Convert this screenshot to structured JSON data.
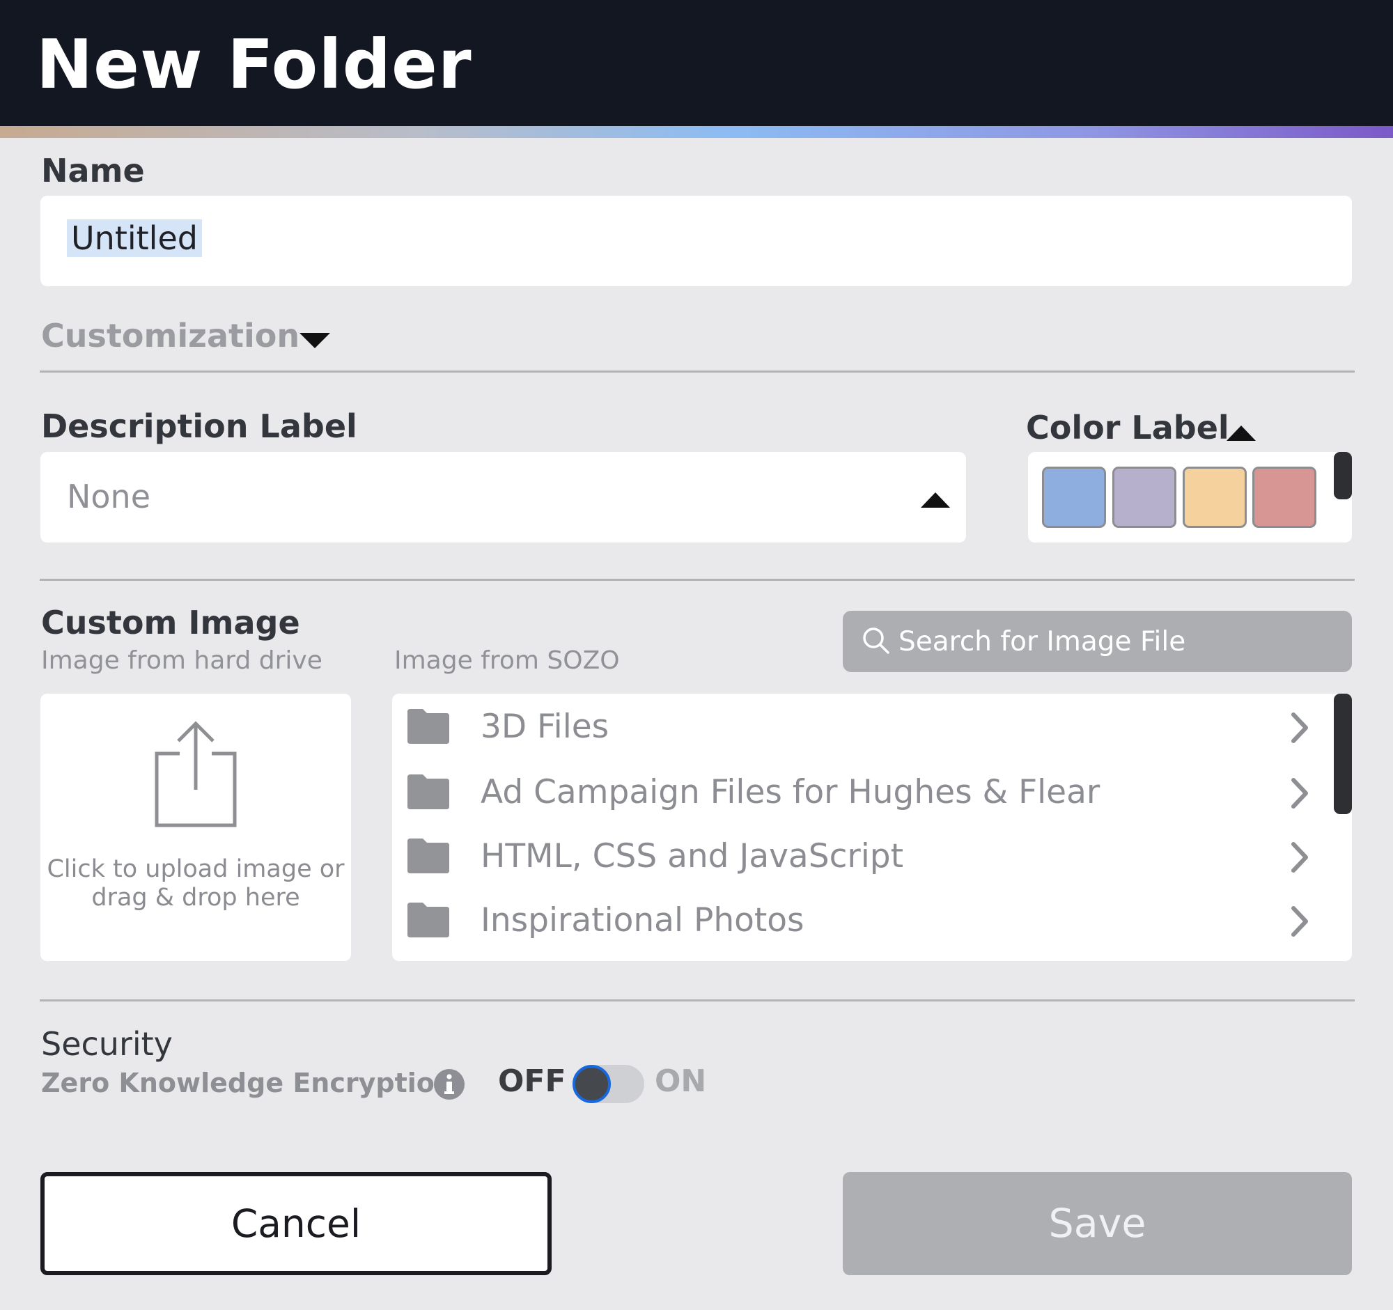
{
  "dialog": {
    "title": "New Folder"
  },
  "name_field": {
    "label": "Name",
    "value": "Untitled"
  },
  "customization": {
    "label": "Customization"
  },
  "description": {
    "label": "Description Label",
    "value": "None"
  },
  "color_label": {
    "label": "Color Label",
    "swatches": [
      "#8eaee0",
      "#b6b0cd",
      "#f5d29d",
      "#d79594"
    ]
  },
  "custom_image": {
    "title": "Custom Image",
    "hard_drive_label": "Image from hard drive",
    "sozo_label": "Image from SOZO",
    "search_placeholder": "Search for Image File",
    "upload_text": "Click to upload image or drag & drop here",
    "folders": [
      "3D Files",
      "Ad Campaign Files for Hughes & Flear",
      "HTML, CSS and JavaScript",
      "Inspirational Photos"
    ]
  },
  "security": {
    "title": "Security",
    "zke_label": "Zero Knowledge Encryption",
    "toggle_off_label": "OFF",
    "toggle_on_label": "ON",
    "toggle_state": "off"
  },
  "actions": {
    "cancel_label": "Cancel",
    "save_label": "Save"
  },
  "colors": {
    "header_bg": "#131722",
    "toggle_focus": "#1769e0"
  }
}
